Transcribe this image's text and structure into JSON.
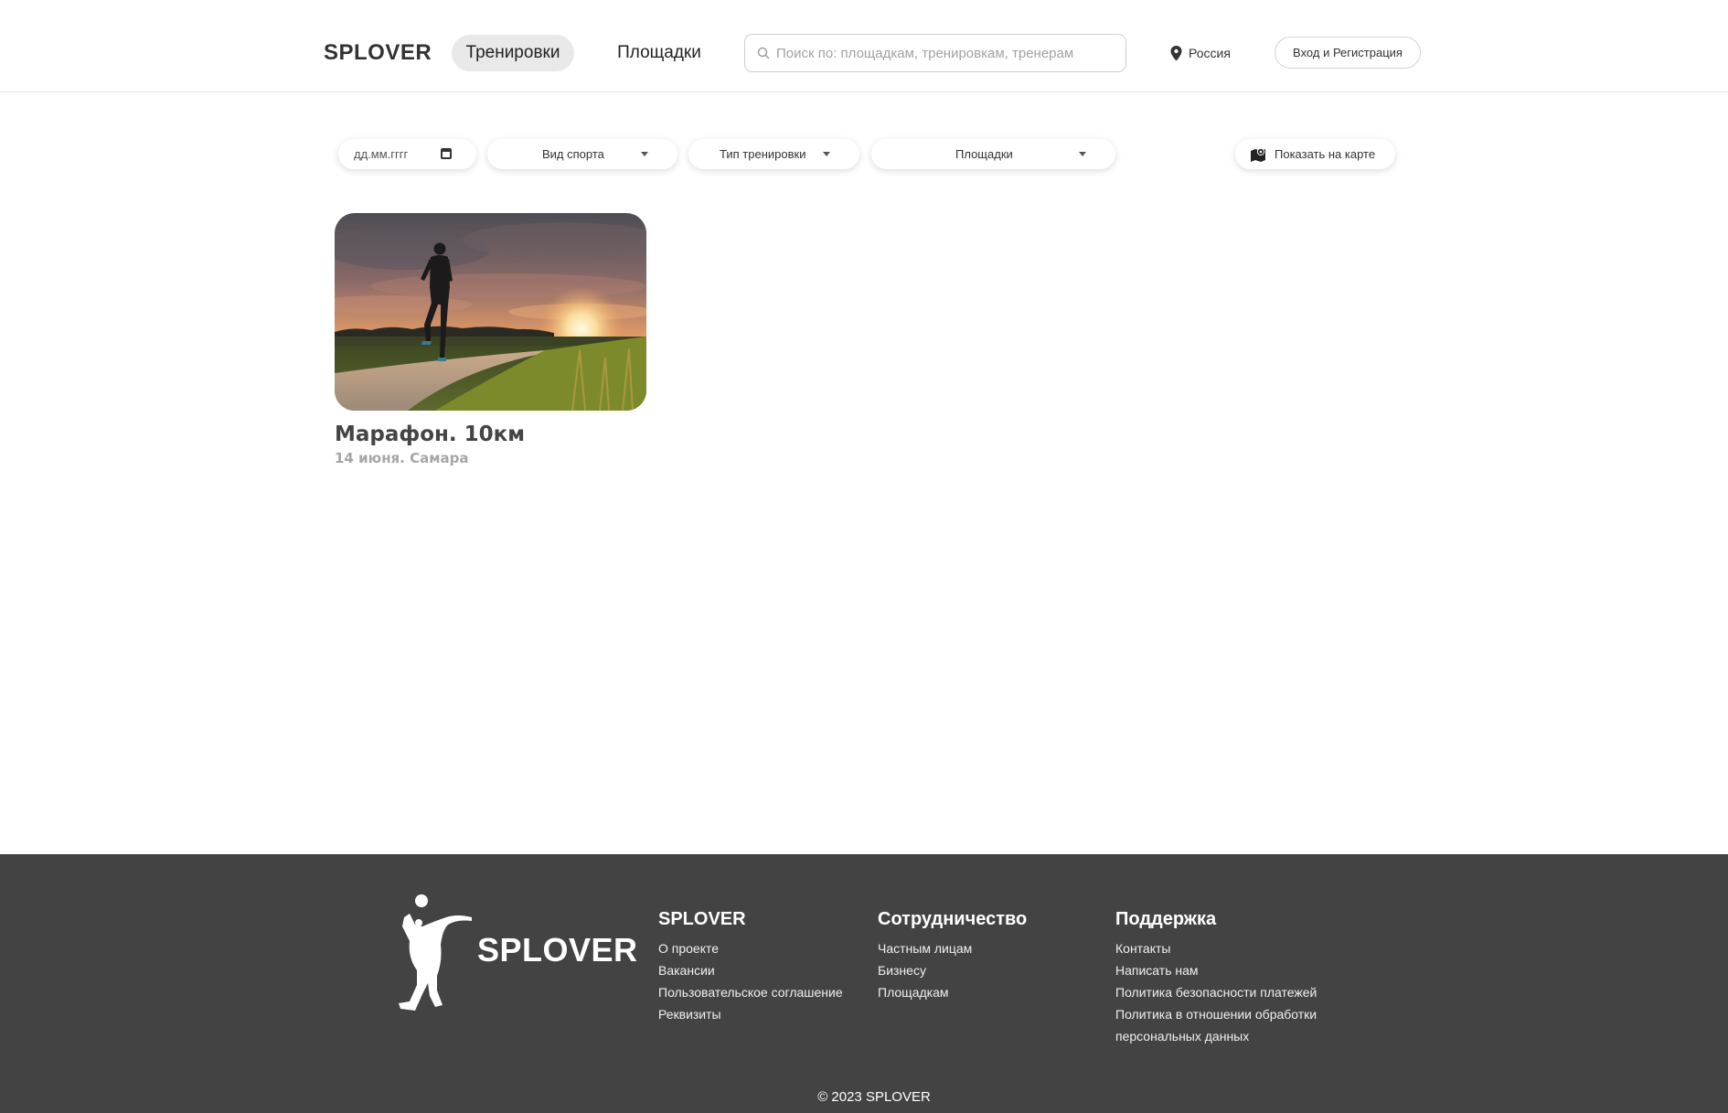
{
  "header": {
    "logo": "SPLOVER",
    "nav": [
      {
        "label": "Тренировки",
        "active": true
      },
      {
        "label": "Площадки",
        "active": false
      }
    ],
    "search_placeholder": "Поиск по: площадкам, тренировкам, тренерам",
    "region": "Россия",
    "login_label": "Вход и Регистрация"
  },
  "filters": {
    "date_placeholder": "дд.мм.гггг",
    "sport_label": "Вид спорта",
    "type_label": "Тип тренировки",
    "venue_label": "Площадки",
    "map_label": "Показать на карте"
  },
  "cards": [
    {
      "title": "Марафон. 10км",
      "meta": "14 июня. Самара"
    }
  ],
  "footer": {
    "brand": "SPLOVER",
    "columns": [
      {
        "title": "SPLOVER",
        "links": [
          "О проекте",
          "Вакансии",
          "Пользовательское соглашение",
          "Реквизиты"
        ]
      },
      {
        "title": "Сотрудничество",
        "links": [
          "Частным лицам",
          "Бизнесу",
          "Площадкам"
        ]
      },
      {
        "title": "Поддержка",
        "links": [
          "Контакты",
          "Написать нам",
          "Политика безопасности платежей",
          "Политика в отношении обработки",
          "персональных данных"
        ]
      }
    ],
    "copyright": "© 2023 SPLOVER"
  },
  "colors": {
    "footer_bg": "#434343",
    "active_pill_bg": "#e9e9e9",
    "text": "#333333",
    "muted": "#a6a6a6"
  },
  "icons": [
    "search-icon",
    "location-pin-icon",
    "calendar-icon",
    "chevron-down-icon",
    "map-icon",
    "jumping-athlete-logo"
  ]
}
